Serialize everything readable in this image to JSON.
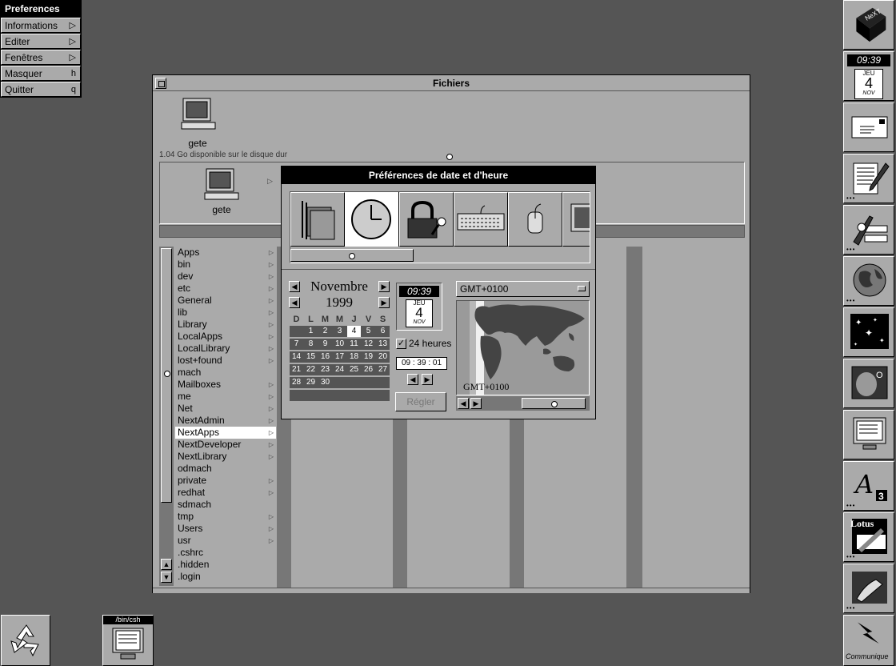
{
  "menu": {
    "title": "Preferences",
    "items": [
      {
        "label": "Informations",
        "key": "▷"
      },
      {
        "label": "Editer",
        "key": "▷"
      },
      {
        "label": "Fenêtres",
        "key": "▷"
      },
      {
        "label": "Masquer",
        "key": "h"
      },
      {
        "label": "Quitter",
        "key": "q"
      }
    ]
  },
  "dock": {
    "clock_time": "09:39",
    "clock_day": "JEU",
    "clock_date": "4",
    "clock_month": "NOV",
    "lotus_label": "Lotus",
    "communique_label": "Communique"
  },
  "fichiers": {
    "title": "Fichiers",
    "shelf_host": "gete",
    "disk_info": "1.04 Go disponible sur le disque dur",
    "path_host": "gete",
    "folders": [
      {
        "name": "Apps",
        "dir": true
      },
      {
        "name": "bin",
        "dir": true
      },
      {
        "name": "dev",
        "dir": true
      },
      {
        "name": "etc",
        "dir": true
      },
      {
        "name": "General",
        "dir": true
      },
      {
        "name": "lib",
        "dir": true
      },
      {
        "name": "Library",
        "dir": true
      },
      {
        "name": "LocalApps",
        "dir": true
      },
      {
        "name": "LocalLibrary",
        "dir": true
      },
      {
        "name": "lost+found",
        "dir": true
      },
      {
        "name": "mach",
        "dir": false
      },
      {
        "name": "Mailboxes",
        "dir": true
      },
      {
        "name": "me",
        "dir": true
      },
      {
        "name": "Net",
        "dir": true
      },
      {
        "name": "NextAdmin",
        "dir": true
      },
      {
        "name": "NextApps",
        "dir": true,
        "selected": true
      },
      {
        "name": "NextDeveloper",
        "dir": true
      },
      {
        "name": "NextLibrary",
        "dir": true
      },
      {
        "name": "odmach",
        "dir": false
      },
      {
        "name": "private",
        "dir": true
      },
      {
        "name": "redhat",
        "dir": true
      },
      {
        "name": "sdmach",
        "dir": false
      },
      {
        "name": "tmp",
        "dir": true
      },
      {
        "name": "Users",
        "dir": true
      },
      {
        "name": "usr",
        "dir": true
      },
      {
        "name": ".cshrc",
        "dir": false
      },
      {
        "name": ".hidden",
        "dir": false
      },
      {
        "name": ".login",
        "dir": false
      }
    ]
  },
  "prefs": {
    "title": "Préférences de date et d'heure",
    "calendar": {
      "month": "Novembre",
      "year": "1999",
      "weekdays": [
        "D",
        "L",
        "M",
        "M",
        "J",
        "V",
        "S"
      ],
      "first_weekday": 1,
      "days_in_month": 30,
      "today": 4
    },
    "clock": {
      "time": "09:39",
      "day": "JEU",
      "date": "4",
      "month": "NOV"
    },
    "hours24_label": "24 heures",
    "hours24_checked": true,
    "time_field": "09 : 39 : 01",
    "set_button": "Régler",
    "timezone": "GMT+0100",
    "map_label": "GMT+0100"
  },
  "terminal": {
    "title": "/bin/csh"
  }
}
